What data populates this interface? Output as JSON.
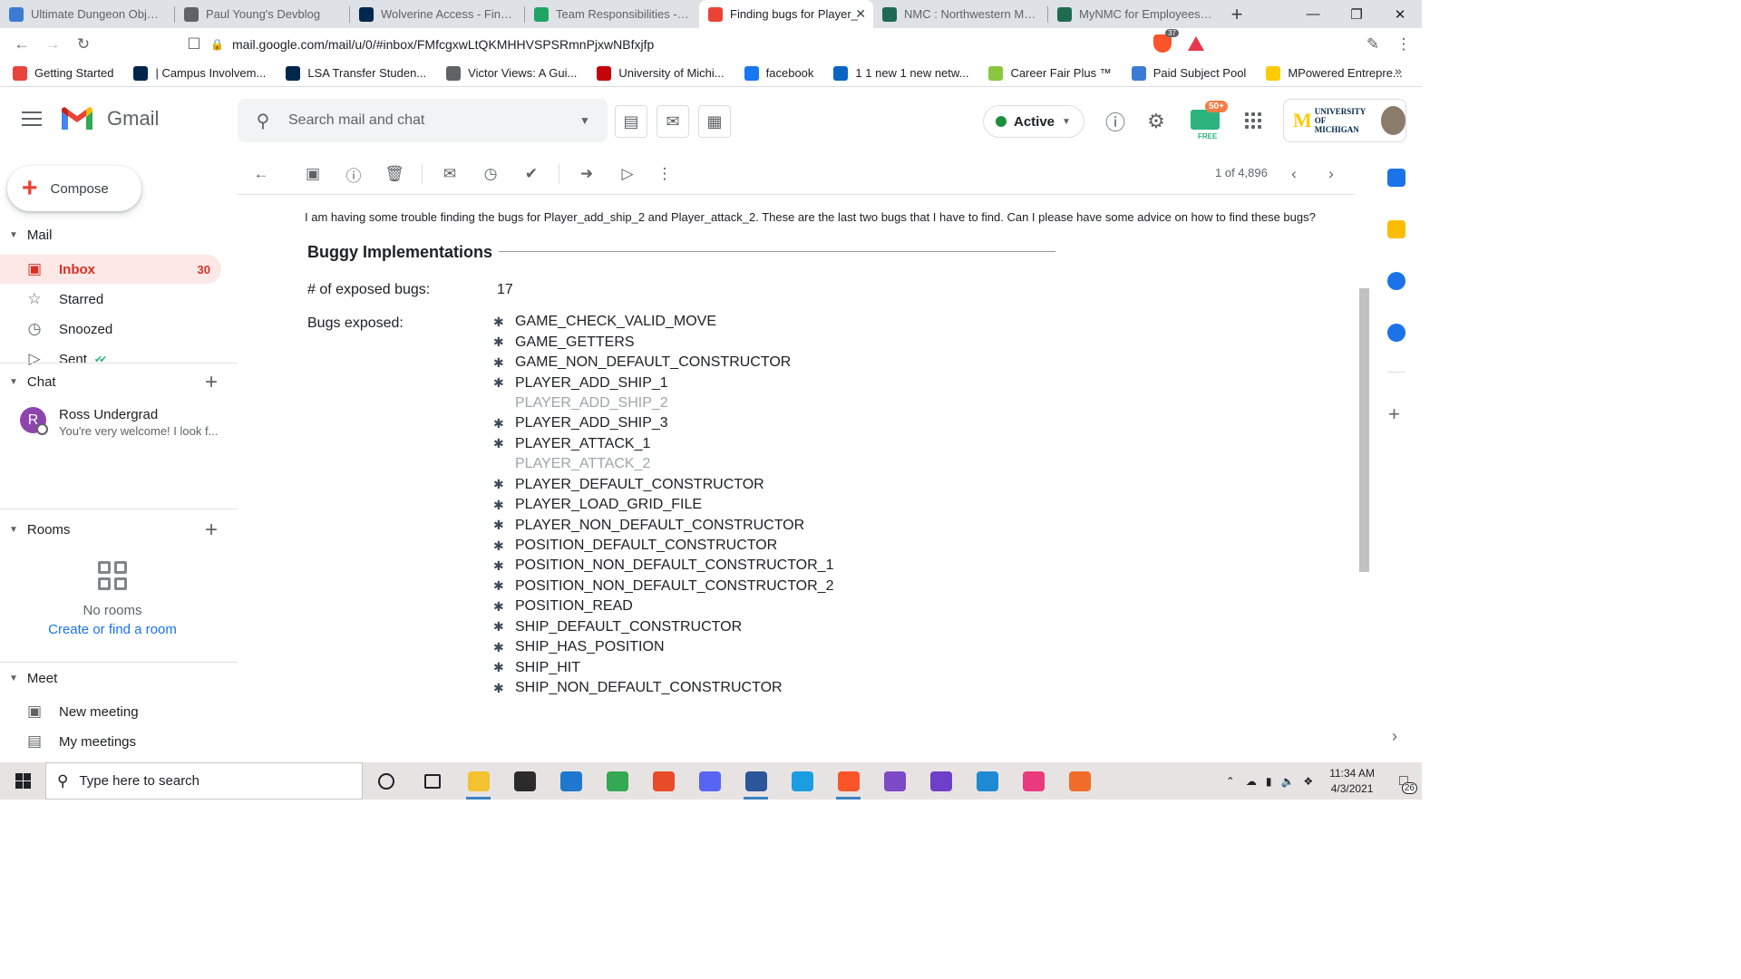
{
  "browser": {
    "tabs": [
      {
        "title": "Ultimate Dungeon Objective",
        "color": "#3b7bd4",
        "active": false
      },
      {
        "title": "Paul Young's Devblog",
        "color": "#5f6368",
        "active": false
      },
      {
        "title": "Wolverine Access - Find & Fa",
        "color": "#00274c",
        "active": false
      },
      {
        "title": "Team Responsibilities - ENTR",
        "color": "#1fa463",
        "active": false
      },
      {
        "title": "Finding bugs for Player_",
        "color": "#ea4335",
        "active": true
      },
      {
        "title": "NMC : Northwestern Michig",
        "color": "#1e6b52",
        "active": false
      },
      {
        "title": "MyNMC for Employees - Ho",
        "color": "#1e6b52",
        "active": false
      }
    ],
    "url": "mail.google.com/mail/u/0/#inbox/FMfcgxwLtQKMHHVSPSRmnPjxwNBfxjfp",
    "brave_count": "37",
    "bookmarks": [
      {
        "label": "Getting Started",
        "color": "#e8453c"
      },
      {
        "label": "| Campus Involvem...",
        "color": "#00274c"
      },
      {
        "label": "LSA Transfer Studen...",
        "color": "#00274c"
      },
      {
        "label": "Victor Views: A Gui...",
        "color": "#5f6368"
      },
      {
        "label": "University of Michi...",
        "color": "#c5050c"
      },
      {
        "label": "facebook",
        "color": "#1877f2"
      },
      {
        "label": "1 1 new 1 new netw...",
        "color": "#0a66c2"
      },
      {
        "label": "Career Fair Plus ™",
        "color": "#8cc63f"
      },
      {
        "label": "Paid Subject Pool",
        "color": "#3b7bd4"
      },
      {
        "label": "MPowered Entrepre...",
        "color": "#ffcb05"
      }
    ]
  },
  "gmail": {
    "app_name": "Gmail",
    "search_placeholder": "Search mail and chat",
    "status": "Active",
    "mailtrack_badge": "50+",
    "mailtrack_free": "FREE",
    "umich_line1": "UNIVERSITY OF",
    "umich_line2": "MICHIGAN",
    "compose_label": "Compose",
    "mail_section": "Mail",
    "nav": [
      {
        "label": "Inbox",
        "icon": "inbox-icon",
        "count": "30",
        "selected": true
      },
      {
        "label": "Starred",
        "icon": "star-icon",
        "count": "",
        "selected": false
      },
      {
        "label": "Snoozed",
        "icon": "clock-icon",
        "count": "",
        "selected": false
      },
      {
        "label": "Sent",
        "icon": "send-icon",
        "count": "",
        "selected": false
      }
    ],
    "chat_section": "Chat",
    "chat_user": {
      "initial": "R",
      "name": "Ross Undergrad",
      "preview": "You're very welcome! I look f..."
    },
    "rooms_section": "Rooms",
    "no_rooms": "No rooms",
    "create_room": "Create or find a room",
    "meet_section": "Meet",
    "meet_items": [
      {
        "label": "New meeting",
        "icon": "video-plus-icon"
      },
      {
        "label": "My meetings",
        "icon": "calendar-icon"
      }
    ],
    "pager": "1 of 4,896"
  },
  "message": {
    "intro": "I am having some trouble finding the bugs for Player_add_ship_2 and Player_attack_2. These are the last two bugs that I have to find. Can I please have some advice on how to find these bugs?",
    "heading": "Buggy Implementations",
    "exposed_count_label": "# of exposed bugs:",
    "exposed_count": "17",
    "bugs_label": "Bugs exposed:",
    "bugs": [
      {
        "name": "GAME_CHECK_VALID_MOVE",
        "exposed": true
      },
      {
        "name": "GAME_GETTERS",
        "exposed": true
      },
      {
        "name": "GAME_NON_DEFAULT_CONSTRUCTOR",
        "exposed": true
      },
      {
        "name": "PLAYER_ADD_SHIP_1",
        "exposed": true
      },
      {
        "name": "PLAYER_ADD_SHIP_2",
        "exposed": false
      },
      {
        "name": "PLAYER_ADD_SHIP_3",
        "exposed": true
      },
      {
        "name": "PLAYER_ATTACK_1",
        "exposed": true
      },
      {
        "name": "PLAYER_ATTACK_2",
        "exposed": false
      },
      {
        "name": "PLAYER_DEFAULT_CONSTRUCTOR",
        "exposed": true
      },
      {
        "name": "PLAYER_LOAD_GRID_FILE",
        "exposed": true
      },
      {
        "name": "PLAYER_NON_DEFAULT_CONSTRUCTOR",
        "exposed": true
      },
      {
        "name": "POSITION_DEFAULT_CONSTRUCTOR",
        "exposed": true
      },
      {
        "name": "POSITION_NON_DEFAULT_CONSTRUCTOR_1",
        "exposed": true
      },
      {
        "name": "POSITION_NON_DEFAULT_CONSTRUCTOR_2",
        "exposed": true
      },
      {
        "name": "POSITION_READ",
        "exposed": true
      },
      {
        "name": "SHIP_DEFAULT_CONSTRUCTOR",
        "exposed": true
      },
      {
        "name": "SHIP_HAS_POSITION",
        "exposed": true
      },
      {
        "name": "SHIP_HIT",
        "exposed": true
      },
      {
        "name": "SHIP_NON_DEFAULT_CONSTRUCTOR",
        "exposed": true
      }
    ]
  },
  "taskbar": {
    "search_placeholder": "Type here to search",
    "time": "11:34 AM",
    "date": "4/3/2021",
    "notification_count": "26",
    "apps": [
      {
        "name": "cortana-icon",
        "color": "#202124",
        "open": false
      },
      {
        "name": "task-view-icon",
        "color": "#202124",
        "open": false
      },
      {
        "name": "file-explorer-icon",
        "color": "#f2c230",
        "open": true
      },
      {
        "name": "store-icon",
        "color": "#2b2b2b",
        "open": false
      },
      {
        "name": "mail-icon",
        "color": "#1e78d0",
        "open": false
      },
      {
        "name": "chrome-icon",
        "color": "#34a853",
        "open": false
      },
      {
        "name": "office-icon",
        "color": "#e84b2a",
        "open": false
      },
      {
        "name": "discord-icon",
        "color": "#5865f2",
        "open": false
      },
      {
        "name": "word-icon",
        "color": "#2b579a",
        "open": true
      },
      {
        "name": "edge-icon",
        "color": "#1b9de2",
        "open": false
      },
      {
        "name": "brave-icon",
        "color": "#fb542b",
        "open": true
      },
      {
        "name": "visual-studio-icon",
        "color": "#7d4ac7",
        "open": false
      },
      {
        "name": "github-desktop-icon",
        "color": "#6e40c9",
        "open": false
      },
      {
        "name": "vscode-icon",
        "color": "#1f8ad2",
        "open": false
      },
      {
        "name": "creative-cloud-icon",
        "color": "#e83a7c",
        "open": false
      },
      {
        "name": "firefox-icon",
        "color": "#f06d2a",
        "open": false
      }
    ]
  }
}
